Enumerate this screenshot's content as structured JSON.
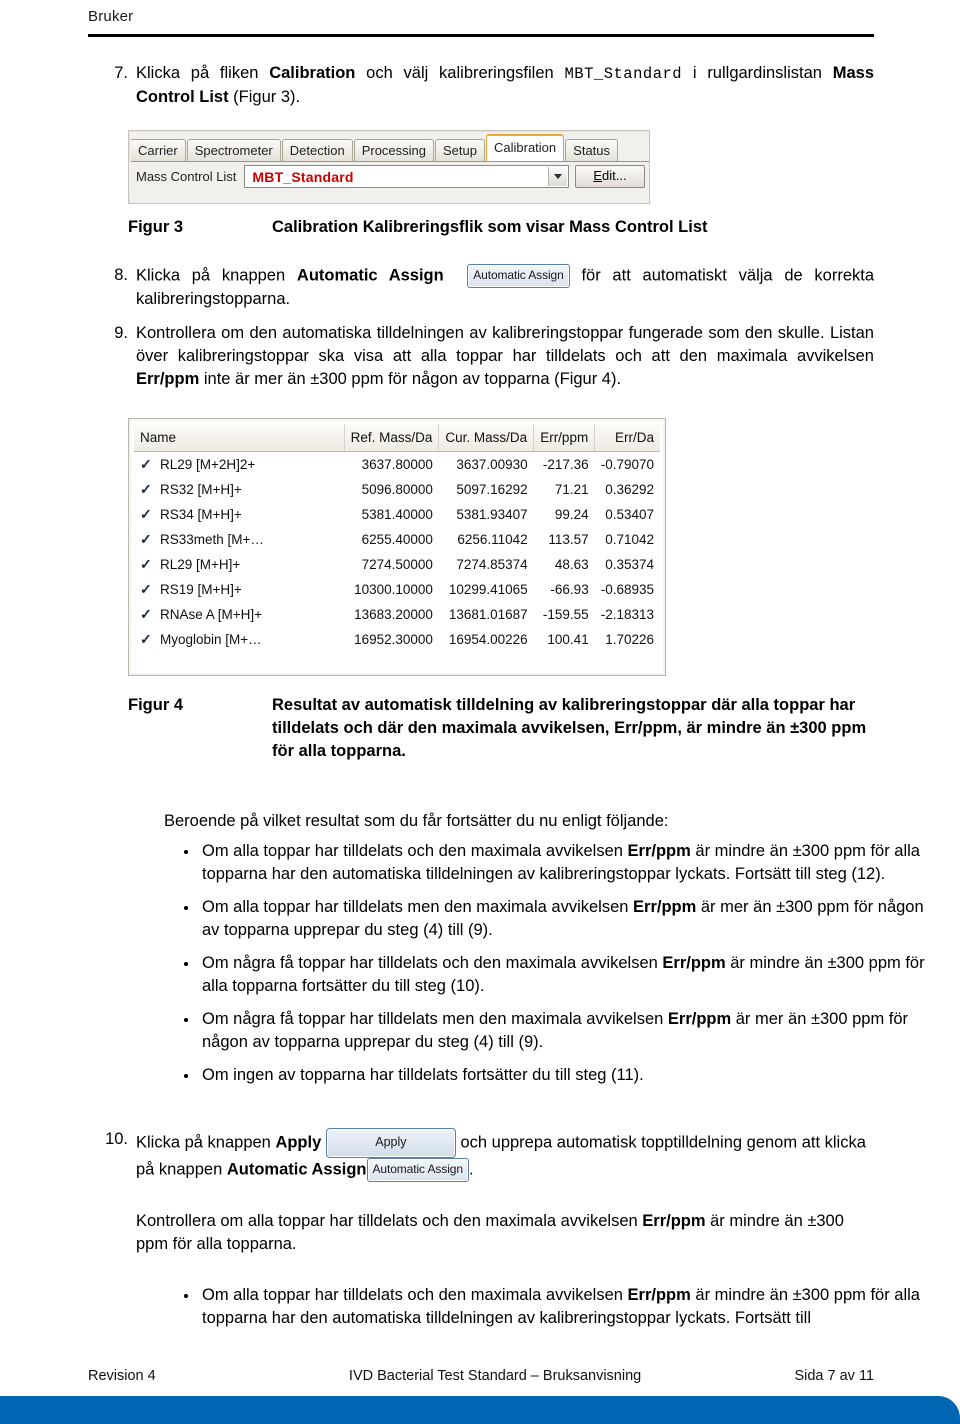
{
  "header": {
    "brand": "Bruker"
  },
  "steps": {
    "s7": {
      "num": "7.",
      "t1": "Klicka på fliken ",
      "b1": "Calibration",
      "t2": " och välj kalibreringsfilen ",
      "mono": "MBT_Standard",
      "t3": " i rullgardinslistan ",
      "b2": "Mass Control List",
      "t4": " (Figur 3)."
    },
    "s8": {
      "num": "8.",
      "t1": "Klicka på knappen ",
      "b1": "Automatic Assign",
      "button": "Automatic Assign",
      "t2": " för att automatiskt välja de korrekta kalibreringstopparna."
    },
    "s9": {
      "num": "9.",
      "t1": "Kontrollera om den automatiska tilldelningen av kalibreringstoppar fungerade som den skulle. Listan över kalibreringstoppar ska visa att alla toppar har tilldelats och att den maximala avvikelsen ",
      "b1": "Err/ppm",
      "t2": " inte är mer än ±300 ppm för någon av topparna (Figur 4)."
    },
    "s10": {
      "num": "10.",
      "t1": "Klicka på knappen ",
      "b1": "Apply",
      "apply_button": "Apply",
      "t2": " och upprepa automatisk topptilldelning genom att klicka på knappen ",
      "b2": "Automatic Assign",
      "assign_button": "Automatic Assign",
      "t3": ".",
      "t4": "Kontrollera om alla toppar har tilldelats och den maximala avvikelsen ",
      "b3": "Err/ppm",
      "t5": " är mindre än ±300 ppm för alla topparna."
    }
  },
  "figure3": {
    "caption_label": "Figur 3",
    "caption_text": "Calibration Kalibreringsflik som visar Mass Control List",
    "tabs": [
      {
        "label": "Carrier",
        "active": false,
        "clipped": true
      },
      {
        "label": "Spectrometer",
        "active": false,
        "clipped": false
      },
      {
        "label": "Detection",
        "active": false,
        "clipped": false
      },
      {
        "label": "Processing",
        "active": false,
        "clipped": false
      },
      {
        "label": "Setup",
        "active": false,
        "clipped": false
      },
      {
        "label": "Calibration",
        "active": true,
        "clipped": false
      },
      {
        "label": "Status",
        "active": false,
        "clipped": false
      }
    ],
    "mass_control_list_label": "Mass Control List",
    "mass_control_list_value": "MBT_Standard",
    "edit_button": "Edit...",
    "accent_color": "#f0a830",
    "value_color": "#cc0000"
  },
  "figure4": {
    "caption_label": "Figur 4",
    "caption_text": "Resultat av automatisk tilldelning av kalibreringstoppar där alla toppar har tilldelats och där den maximala avvikelsen, Err/ppm, är mindre än ±300 ppm för alla topparna.",
    "columns": [
      "Name",
      "Ref. Mass/Da",
      "Cur. Mass/Da",
      "Err/ppm",
      "Err/Da"
    ],
    "check_glyph": "✓",
    "rows": [
      {
        "checked": true,
        "name": "RL29 [M+2H]2+",
        "ref_mass": "3637.80000",
        "cur_mass": "3637.00930",
        "err_ppm": "-217.36",
        "err_da": "-0.79070"
      },
      {
        "checked": true,
        "name": "RS32 [M+H]+",
        "ref_mass": "5096.80000",
        "cur_mass": "5097.16292",
        "err_ppm": "71.21",
        "err_da": "0.36292"
      },
      {
        "checked": true,
        "name": "RS34 [M+H]+",
        "ref_mass": "5381.40000",
        "cur_mass": "5381.93407",
        "err_ppm": "99.24",
        "err_da": "0.53407"
      },
      {
        "checked": true,
        "name": "RS33meth [M+…",
        "ref_mass": "6255.40000",
        "cur_mass": "6256.11042",
        "err_ppm": "113.57",
        "err_da": "0.71042"
      },
      {
        "checked": true,
        "name": "RL29 [M+H]+",
        "ref_mass": "7274.50000",
        "cur_mass": "7274.85374",
        "err_ppm": "48.63",
        "err_da": "0.35374"
      },
      {
        "checked": true,
        "name": "RS19 [M+H]+",
        "ref_mass": "10300.10000",
        "cur_mass": "10299.41065",
        "err_ppm": "-66.93",
        "err_da": "-0.68935"
      },
      {
        "checked": true,
        "name": "RNAse A [M+H]+",
        "ref_mass": "13683.20000",
        "cur_mass": "13681.01687",
        "err_ppm": "-159.55",
        "err_da": "-2.18313"
      },
      {
        "checked": true,
        "name": "Myoglobin [M+…",
        "ref_mass": "16952.30000",
        "cur_mass": "16954.00226",
        "err_ppm": "100.41",
        "err_da": "1.70226"
      }
    ]
  },
  "intro_para": "Beroende på vilket resultat som du får fortsätter du nu enligt följande:",
  "bullets1": [
    {
      "t1": "Om alla toppar har tilldelats och den maximala avvikelsen ",
      "b": "Err/ppm",
      "t2": " är mindre än ±300 ppm för alla topparna har den automatiska tilldelningen av kalibreringstoppar lyckats. Fortsätt till steg (12)."
    },
    {
      "t1": "Om alla toppar har tilldelats men den maximala avvikelsen ",
      "b": "Err/ppm",
      "t2": " är mer än ±300 ppm för någon av topparna upprepar du steg (4) till (9)."
    },
    {
      "t1": "Om några få toppar har tilldelats och den maximala avvikelsen ",
      "b": "Err/ppm",
      "t2": " är mindre än ±300 ppm för alla topparna fortsätter du till steg (10)."
    },
    {
      "t1": "Om några få toppar har tilldelats men den maximala avvikelsen ",
      "b": "Err/ppm",
      "t2": " är mer än ±300 ppm för någon av topparna upprepar du steg (4) till (9)."
    },
    {
      "t1": "Om ingen av topparna har tilldelats fortsätter du till steg (11).",
      "b": "",
      "t2": ""
    }
  ],
  "bullets2": [
    {
      "t1": "Om alla toppar har tilldelats och den maximala avvikelsen ",
      "b": "Err/ppm",
      "t2": " är mindre än ±300 ppm för alla topparna har den automatiska tilldelningen av kalibreringstoppar lyckats. Fortsätt till"
    }
  ],
  "footer": {
    "left": "Revision 4",
    "center": "IVD Bacterial Test Standard – Bruksanvisning",
    "right": "Sida 7 av 11",
    "bar_color": "#0066b3"
  }
}
